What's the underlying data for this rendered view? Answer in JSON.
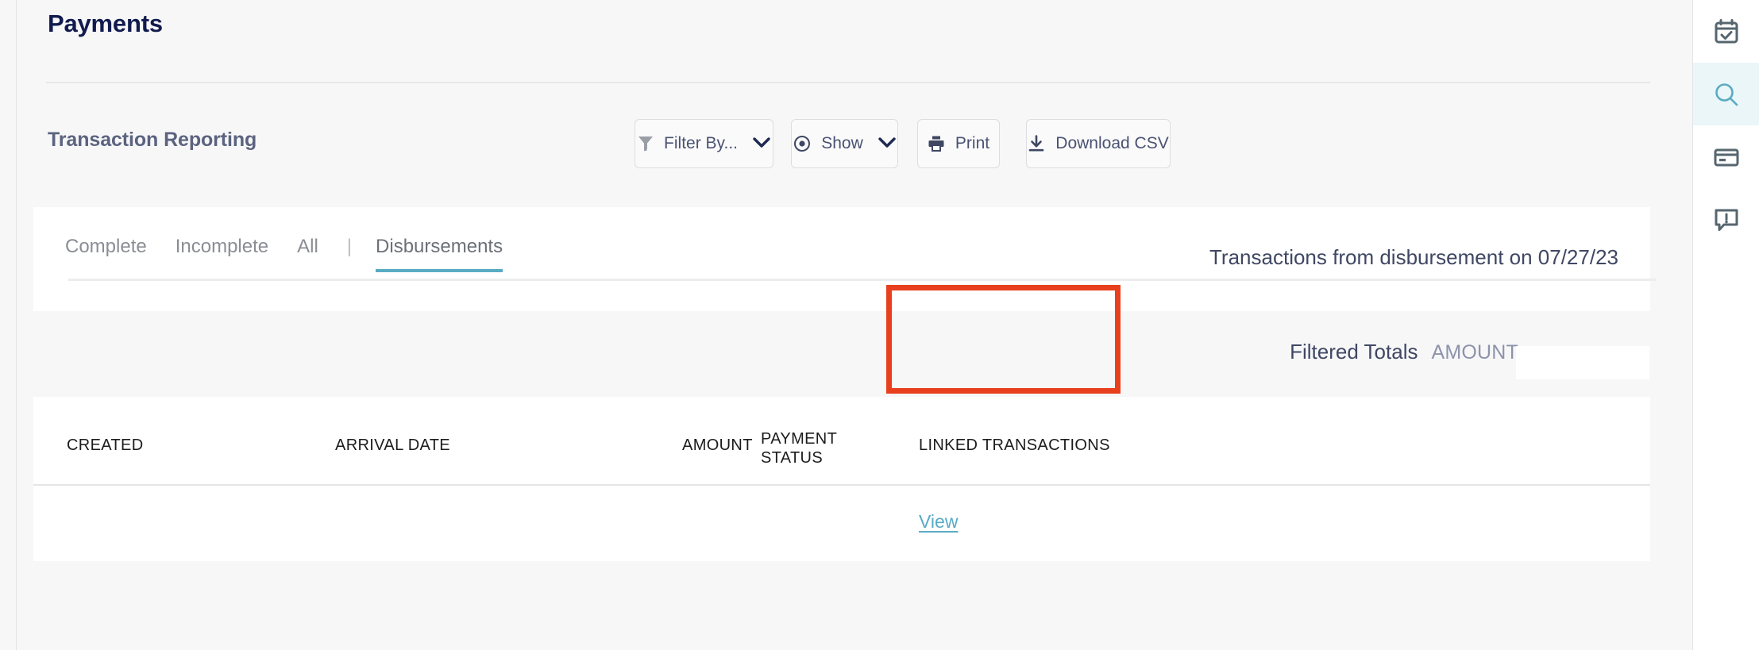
{
  "page": {
    "title": "Payments",
    "section_title": "Transaction Reporting"
  },
  "toolbar": {
    "filter": {
      "label": "Filter By...",
      "icon": "filter-icon",
      "chevron": "chevron-down-icon"
    },
    "show": {
      "label": "Show",
      "icon": "eye-icon",
      "chevron": "chevron-down-icon"
    },
    "print": {
      "label": "Print",
      "icon": "printer-icon"
    },
    "csv": {
      "label": "Download CSV",
      "icon": "download-icon"
    }
  },
  "tabs": {
    "items": [
      {
        "label": "Complete",
        "active": false
      },
      {
        "label": "Incomplete",
        "active": false
      },
      {
        "label": "All",
        "active": false
      },
      {
        "label": "|",
        "active": false
      },
      {
        "label": "Disbursements",
        "active": true
      }
    ],
    "disbursement_note": "Transactions from disbursement on 07/27/23",
    "active_underline_color": "#5aabc4"
  },
  "totals": {
    "label": "Filtered Totals",
    "amount_label": "AMOUNT",
    "amount_value": ""
  },
  "table": {
    "columns": [
      {
        "key": "created",
        "label": "CREATED"
      },
      {
        "key": "arrival_date",
        "label": "ARRIVAL DATE"
      },
      {
        "key": "amount",
        "label": "AMOUNT"
      },
      {
        "key": "payment_status",
        "label": "PAYMENT\nSTATUS"
      },
      {
        "key": "linked_transactions",
        "label": "LINKED TRANSACTIONS"
      }
    ],
    "rows": [
      {
        "created": "",
        "arrival_date": "",
        "amount": "",
        "payment_status": "",
        "linked_transactions": "View"
      }
    ]
  },
  "annotation": {
    "color": "#e8401e",
    "target": "linked-transactions-column"
  },
  "sidebar": {
    "items": [
      {
        "name": "calendar-check-icon",
        "active": false
      },
      {
        "name": "search-icon",
        "active": true
      },
      {
        "name": "credit-card-icon",
        "active": false
      },
      {
        "name": "alert-message-icon",
        "active": false
      }
    ],
    "active_bg": "#eaf6f8",
    "icon_color": "#56666f",
    "active_icon_color": "#5aabc4"
  },
  "colors": {
    "page_bg": "#f7f7f8",
    "card_bg": "#ffffff",
    "title": "#121b4e",
    "section_title": "#5b637f",
    "accent_teal": "#5aabc4",
    "annotation_red": "#e8401e"
  }
}
